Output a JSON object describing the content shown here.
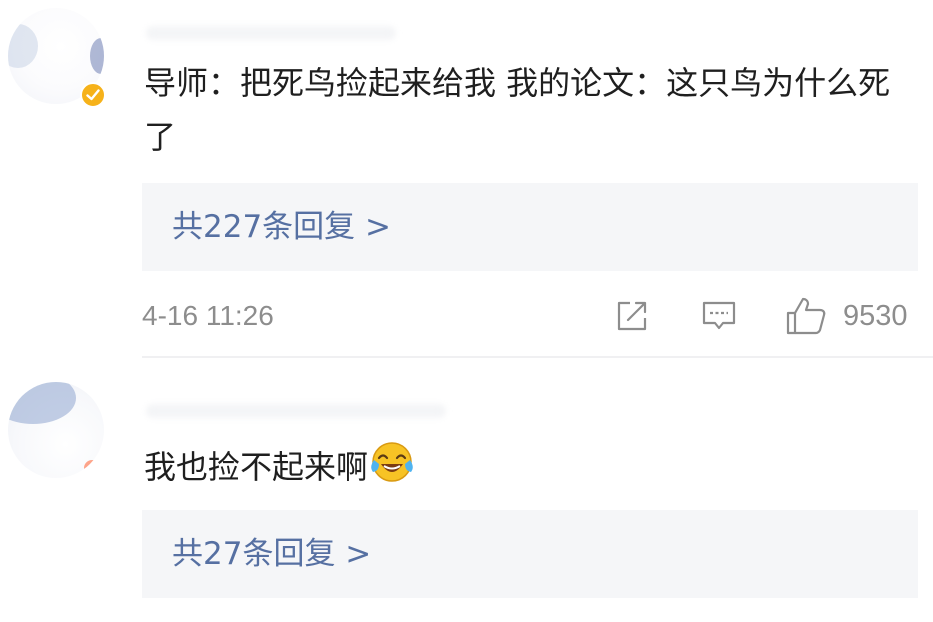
{
  "comments": [
    {
      "verified": true,
      "text": "导师：把死鸟捡起来给我 我的论文：这只鸟为什么死了",
      "reply_summary": "共227条回复 >",
      "timestamp": "4-16 11:26",
      "like_count": "9530"
    },
    {
      "text": "我也捡不起来啊",
      "emoji": "laughing-crying-emoji",
      "reply_summary": "共27条回复 >"
    }
  ],
  "colors": {
    "link": "#5670a2",
    "meta": "#8d8d8d",
    "text": "#1f1f1f",
    "reply_bg": "#f5f6f8",
    "verified_badge": "#f6b21a"
  },
  "icons": [
    "check-icon",
    "share-icon",
    "comment-icon",
    "thumbs-up-icon"
  ]
}
